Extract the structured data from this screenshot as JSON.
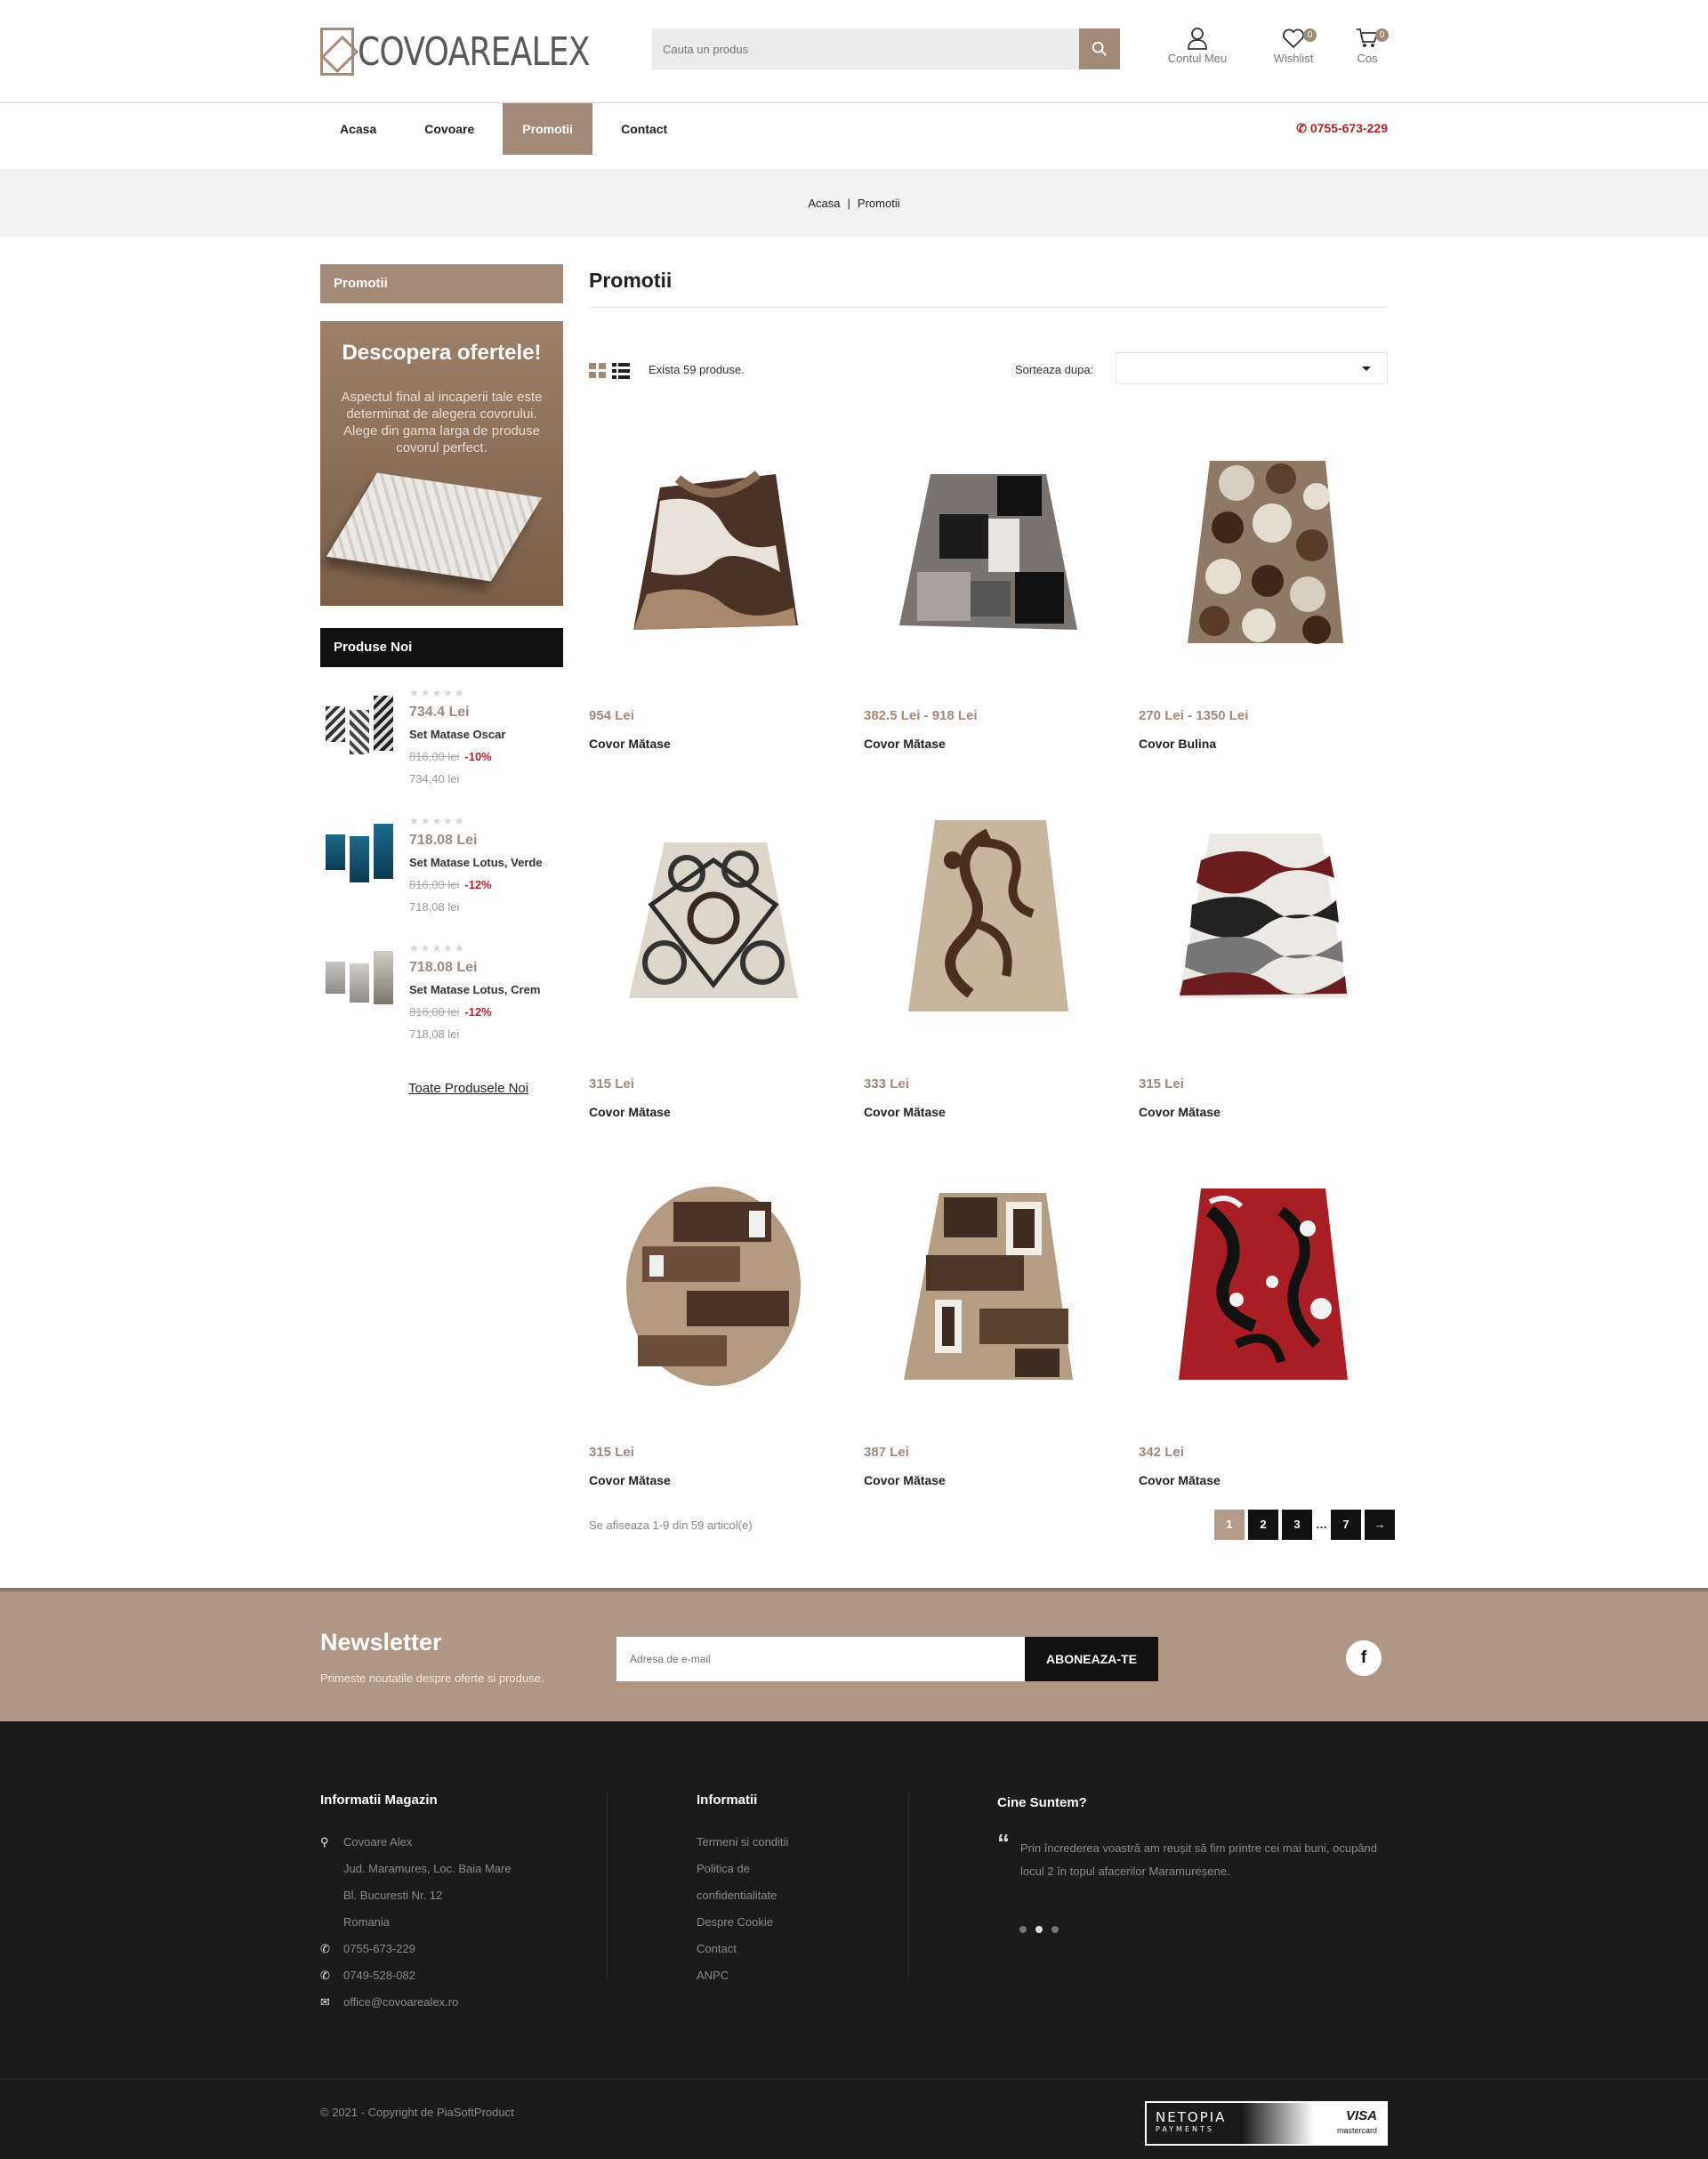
{
  "header": {
    "logo_text": "COVOAREALEX",
    "search_placeholder": "Cauta un produs",
    "account_label": "Contul Meu",
    "wishlist_label": "Wishlist",
    "wishlist_count": "0",
    "cart_label": "Cos",
    "cart_count": "0"
  },
  "nav": {
    "items": [
      {
        "label": "Acasa"
      },
      {
        "label": "Covoare"
      },
      {
        "label": "Promotii",
        "active": true
      },
      {
        "label": "Contact"
      }
    ],
    "phone": "0755-673-229"
  },
  "breadcrumb": {
    "home": "Acasa",
    "sep": "|",
    "current": "Promotii"
  },
  "sidebar": {
    "category_title": "Promotii",
    "banner": {
      "title": "Descopera ofertele!",
      "text": "Aspectul final al incaperii tale este determinat de alegera covorului. Alege din gama larga de produse covorul perfect."
    },
    "new_title": "Produse Noi",
    "stars": "★★★★★",
    "new_products": [
      {
        "price": "734.4 Lei",
        "name": "Set Matase Oscar",
        "old_price": "816,00 lei",
        "discount": "-10%",
        "current": "734,40 lei"
      },
      {
        "price": "718.08 Lei",
        "name": "Set Matase Lotus, Verde",
        "old_price": "816,00 lei",
        "discount": "-12%",
        "current": "718,08 lei"
      },
      {
        "price": "718.08 Lei",
        "name": "Set Matase Lotus, Crem",
        "old_price": "816,00 lei",
        "discount": "-12%",
        "current": "718,08 lei"
      }
    ],
    "all_new_link": "Toate Produsele Noi"
  },
  "main": {
    "title": "Promotii",
    "count_text": "Exista 59 produse.",
    "sort_label": "Sorteaza dupa:",
    "sort_value": "",
    "products": [
      {
        "price": "954 Lei",
        "name": "Covor Mătase"
      },
      {
        "price": "382.5 Lei - 918 Lei",
        "name": "Covor Mătase"
      },
      {
        "price": "270 Lei - 1350 Lei",
        "name": "Covor Bulina"
      },
      {
        "price": "315 Lei",
        "name": "Covor Mătase"
      },
      {
        "price": "333 Lei",
        "name": "Covor Mătase"
      },
      {
        "price": "315 Lei",
        "name": "Covor Mătase"
      },
      {
        "price": "315 Lei",
        "name": "Covor Mătase"
      },
      {
        "price": "387 Lei",
        "name": "Covor Mătase"
      },
      {
        "price": "342 Lei",
        "name": "Covor Mătase"
      }
    ],
    "pager_info": "Se afiseaza 1-9 din 59 articol(e)",
    "pages": [
      "1",
      "2",
      "3",
      "…",
      "7"
    ],
    "next": "→"
  },
  "newsletter": {
    "title": "Newsletter",
    "subtitle": "Primeste noutatile despre oferte si produse.",
    "placeholder": "Adresa de e-mail",
    "button": "ABONEAZA-TE",
    "facebook": "f"
  },
  "footer": {
    "col1_title": "Informatii Magazin",
    "address": [
      "Covoare Alex",
      "Jud. Maramures, Loc. Baia Mare",
      "Bl. Bucuresti Nr. 12",
      "Romania"
    ],
    "phone1": "0755-673-229",
    "phone2": "0749-528-082",
    "email": "office@covoarealex.ro",
    "col2_title": "Informatii",
    "links": [
      "Termeni si conditii",
      "Politica de",
      "confidentialitate",
      "Despre Cookie",
      "Contact",
      "ANPC"
    ],
    "col3_title": "Cine Suntem?",
    "quote": "Prin încrederea voastră am reușit să fim printre cei mai buni, ocupând locul 2 în topul afacerilor Maramureșene.",
    "copyright": "© 2021 - Copyright de PiaSoftProduct",
    "pay_left": "NETOPIA",
    "pay_left_sub": "PAYMENTS",
    "pay_right": "VISA",
    "pay_right_sub": "mastercard"
  },
  "colors": {
    "accent": "#a38978",
    "dark": "#111111",
    "footer_bg": "#1b1b1b",
    "phone": "#b3242a",
    "discount": "#c0222a"
  }
}
